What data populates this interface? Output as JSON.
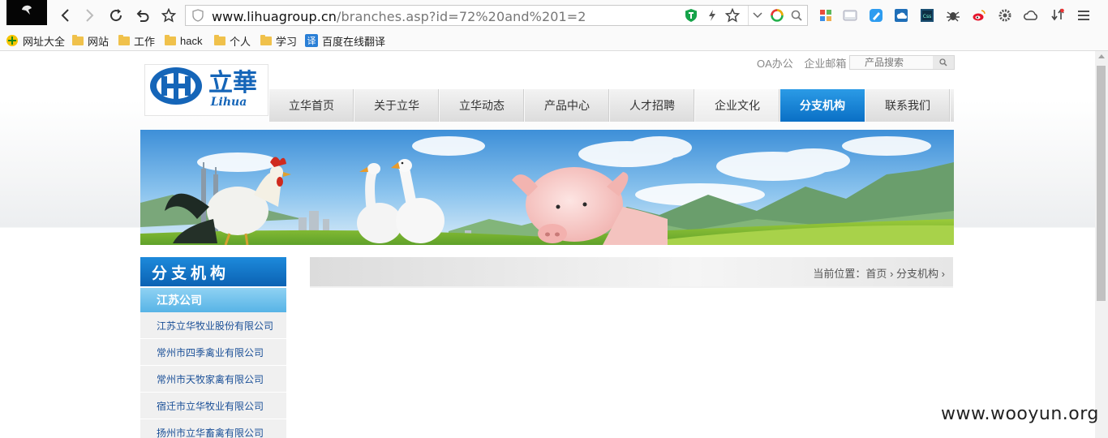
{
  "browser": {
    "url_host": "www.lihuagroup.cn",
    "url_path": "/branches.asp?id=72%20and%201=2",
    "bookmarks": [
      "网址大全",
      "网站",
      "工作",
      "hack",
      "个人",
      "学习",
      "百度在线翻译"
    ]
  },
  "site": {
    "top_links": [
      "OA办公",
      "企业邮箱"
    ],
    "search_placeholder": "产品搜索",
    "logo_text": "立華",
    "logo_latin": "Lihua",
    "nav": [
      "立华首页",
      "关于立华",
      "立华动态",
      "产品中心",
      "人才招聘",
      "企业文化",
      "分支机构",
      "联系我们"
    ],
    "active_nav": "分支机构"
  },
  "sidebar": {
    "title": "分支机构",
    "section": "江苏公司",
    "items": [
      "江苏立华牧业股份有限公司",
      "常州市四季禽业有限公司",
      "常州市天牧家禽有限公司",
      "宿迁市立华牧业有限公司",
      "扬州市立华畜禽有限公司"
    ]
  },
  "breadcrumb": {
    "label": "当前位置：",
    "home": "首页",
    "current": "分支机构"
  },
  "watermark": "www.wooyun.org",
  "colors": {
    "nav_active": "#0a6fc5",
    "sidebar_title": "#0b62b3",
    "sidebar_sub": "#57b4e6",
    "link": "#1a4f97",
    "shield_green": "#16a34a"
  }
}
